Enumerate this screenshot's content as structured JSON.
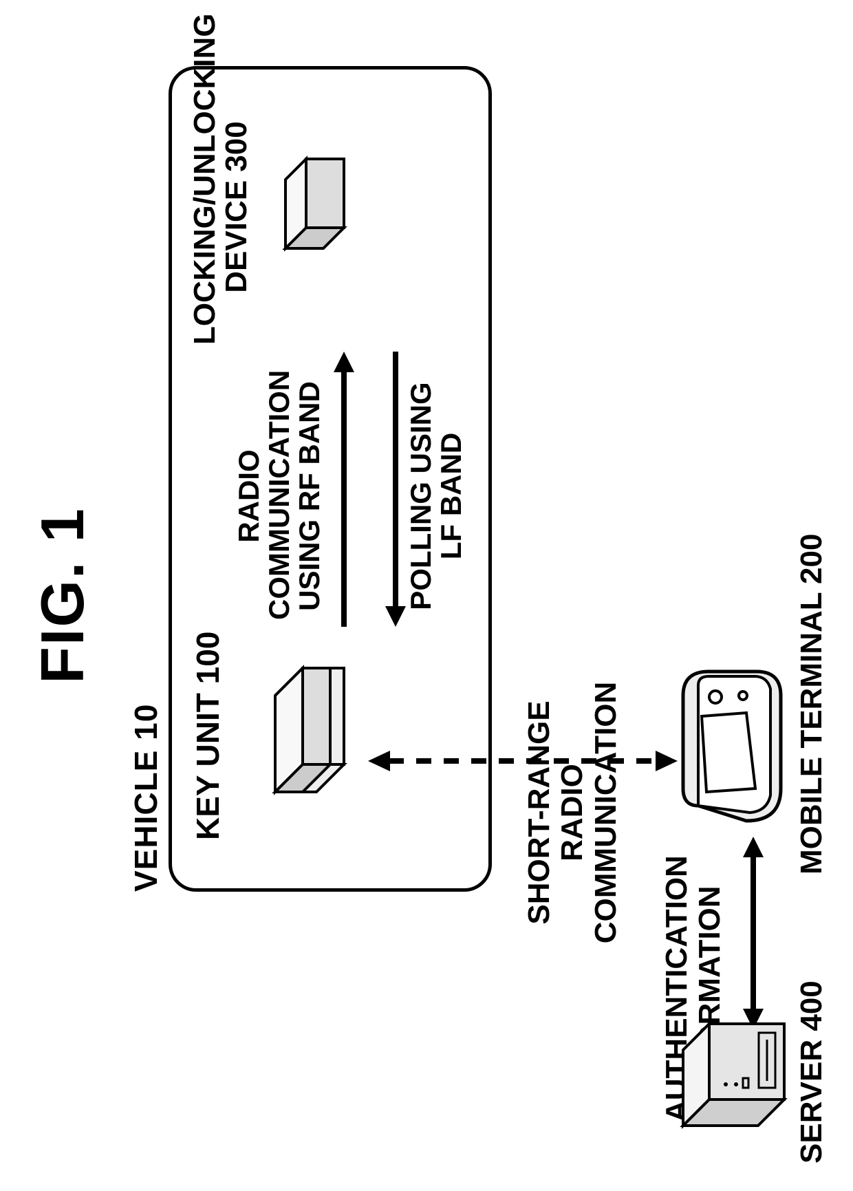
{
  "figure_title": "FIG. 1",
  "vehicle_label": "VEHICLE 10",
  "key_unit_label": "KEY UNIT 100",
  "lock_label_line1": "LOCKING/UNLOCKING",
  "lock_label_line2": "DEVICE 300",
  "rf_line1": "RADIO",
  "rf_line2": "COMMUNICATION",
  "rf_line3": "USING RF BAND",
  "lf_line1": "POLLING USING",
  "lf_line2": "LF BAND",
  "short_range_line1": "SHORT-RANGE RADIO",
  "short_range_line2": "COMMUNICATION",
  "auth_line1": "AUTHENTICATION",
  "auth_line2": "INFORMATION",
  "server_label": "SERVER 400",
  "mobile_label": "MOBILE TERMINAL 200"
}
